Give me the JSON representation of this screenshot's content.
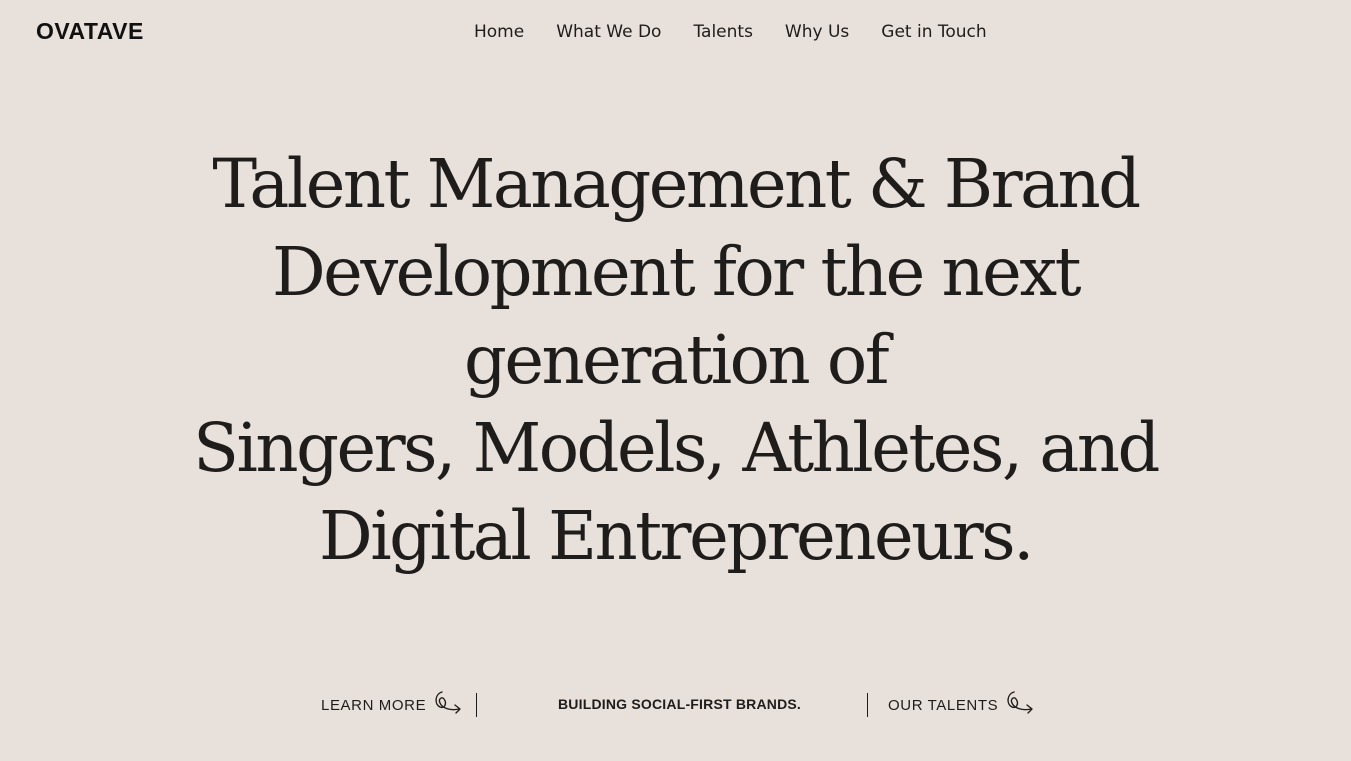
{
  "brand": {
    "logo": "OVATAVE"
  },
  "nav": {
    "items": [
      {
        "label": "Home"
      },
      {
        "label": "What We Do"
      },
      {
        "label": "Talents"
      },
      {
        "label": "Why Us"
      },
      {
        "label": "Get in Touch"
      }
    ]
  },
  "hero": {
    "lines": [
      "Talent Management & Brand",
      "Development for the next",
      "generation of",
      "Singers, Models, Athletes, and",
      "Digital Entrepreneurs."
    ]
  },
  "bottom": {
    "learn_more": "LEARN MORE",
    "tagline": "BUILDING SOCIAL-FIRST BRANDS.",
    "our_talents": "OUR TALENTS",
    "cta_icon": "swirl-arrow-icon"
  },
  "colors": {
    "background": "#e8e0db",
    "text": "#1f1d1b"
  }
}
